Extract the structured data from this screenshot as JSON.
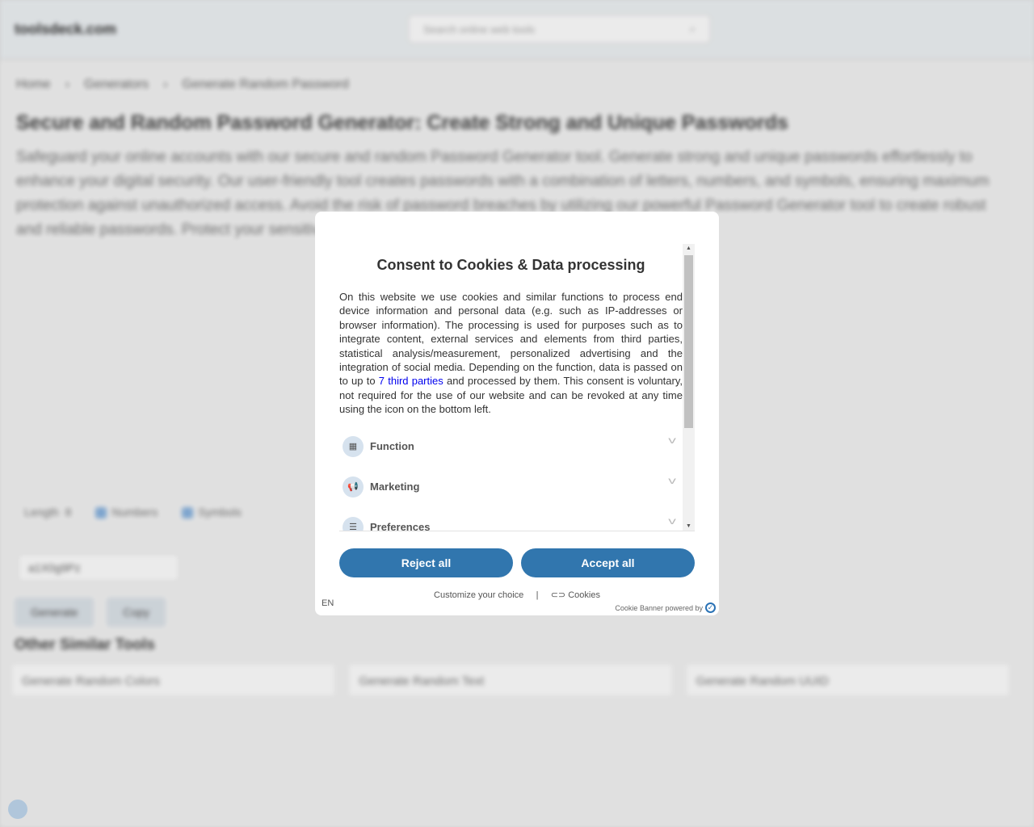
{
  "page": {
    "logo": "toolsdeck.com",
    "search_placeholder": "Search online web tools",
    "breadcrumb": [
      "Home",
      "Generators",
      "Generate Random Password"
    ],
    "title": "Secure and Random Password Generator: Create Strong and Unique Passwords",
    "description": "Safeguard your online accounts with our secure and random Password Generator tool. Generate strong and unique passwords effortlessly to enhance your digital security. Our user-friendly tool creates passwords with a combination of letters, numbers, and symbols, ensuring maximum protection against unauthorized access. Avoid the risk of password breaches by utilizing our powerful Password Generator tool to create robust and reliable passwords. Protect your sensitive information with ease.",
    "options": {
      "length_label": "Length",
      "length_value": "8",
      "numbers": "Numbers",
      "symbols": "Symbols"
    },
    "output_value": "a1X0g9Pz",
    "buttons": [
      "Generate",
      "Copy"
    ],
    "similar_title": "Other Similar Tools",
    "similar": [
      "Generate Random Colors",
      "Generate Random Text",
      "Generate Random UUID"
    ]
  },
  "cookie": {
    "title": "Consent to Cookies & Data processing",
    "text_before": "On this website we use cookies and similar functions to process end device information and personal data (e.g. such as IP-addresses or browser information). The processing is used for purposes such as to integrate content, external services and elements from third parties, statistical analysis/measurement, personalized advertising and the integration of social media. Depending on the function, data is passed on to up to ",
    "link": "7 third parties",
    "text_after": " and processed by them. This consent is voluntary, not required for the use of our website and can be revoked at any time using the icon on the bottom left.",
    "categories": [
      {
        "label": "Function",
        "icon": "grid-icon"
      },
      {
        "label": "Marketing",
        "icon": "megaphone-icon"
      },
      {
        "label": "Preferences",
        "icon": "sliders-icon"
      }
    ],
    "reject": "Reject all",
    "accept": "Accept all",
    "customize": "Customize your choice",
    "separator": "|",
    "cookies_link": "Cookies",
    "language": "EN",
    "powered": "Cookie Banner powered by",
    "accent": "#3176ae"
  }
}
